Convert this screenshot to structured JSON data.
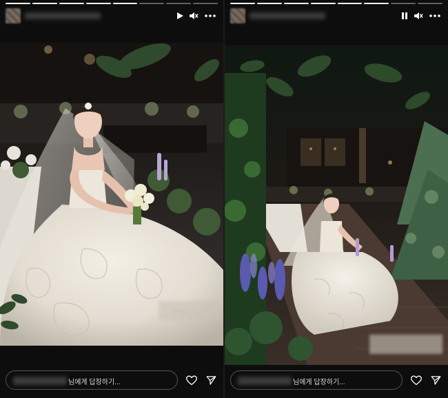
{
  "stories": [
    {
      "state": "playing",
      "progress_segments": [
        1,
        1,
        1,
        1,
        1,
        0,
        0,
        0
      ],
      "reply": {
        "placeholder_suffix": "님에게 답장하기..."
      },
      "icons": {
        "play_pause": "play-icon",
        "mute": "mute-icon",
        "more": "more-icon",
        "like": "heart-icon",
        "share": "send-icon"
      }
    },
    {
      "state": "paused",
      "progress_segments": [
        1,
        1,
        1,
        1,
        1,
        1,
        0,
        0
      ],
      "reply": {
        "placeholder_suffix": "님에게 답장하기..."
      },
      "icons": {
        "play_pause": "pause-icon",
        "mute": "mute-icon",
        "more": "more-icon",
        "like": "heart-icon",
        "share": "send-icon"
      }
    }
  ],
  "colors": {
    "background": "#0b0b0b",
    "input_border": "#555555",
    "text": "#ffffff"
  }
}
